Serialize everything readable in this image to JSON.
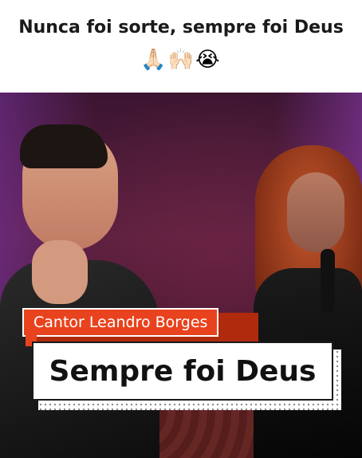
{
  "caption": {
    "text": "Nunca foi sorte, sempre foi Deus",
    "emoji": "🙏🏻🙌🏻😭"
  },
  "video": {
    "lower_third": {
      "tag_label": "Cantor Leandro Borges",
      "title": "Sempre foi Deus"
    },
    "colors": {
      "accent": "#e8431e",
      "title_bg": "#ffffff"
    }
  }
}
